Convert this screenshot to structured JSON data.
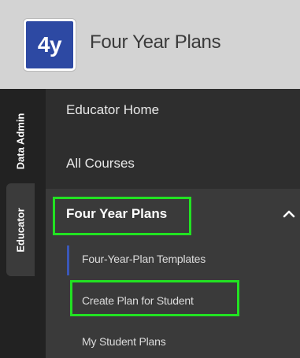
{
  "header": {
    "logo_text": "4y",
    "title": "Four Year Plans"
  },
  "rail": {
    "tabs": [
      {
        "label": "Data Admin",
        "active": false
      },
      {
        "label": "Educator",
        "active": true
      }
    ]
  },
  "nav": {
    "items": [
      {
        "label": "Educator Home"
      },
      {
        "label": "All Courses"
      }
    ],
    "section": {
      "label": "Four Year Plans",
      "expanded": true,
      "icon": "chevron-up-icon",
      "subitems": [
        {
          "label": "Four-Year-Plan Templates",
          "active": true
        },
        {
          "label": "Create Plan for Student",
          "highlighted": true
        },
        {
          "label": "My Student Plans"
        }
      ]
    }
  },
  "colors": {
    "brand": "#2d49a3",
    "highlight": "#22e222",
    "header_bg": "#d3d3d3",
    "nav_bg": "#2e2e2e",
    "active_accent": "#3a57b8"
  }
}
